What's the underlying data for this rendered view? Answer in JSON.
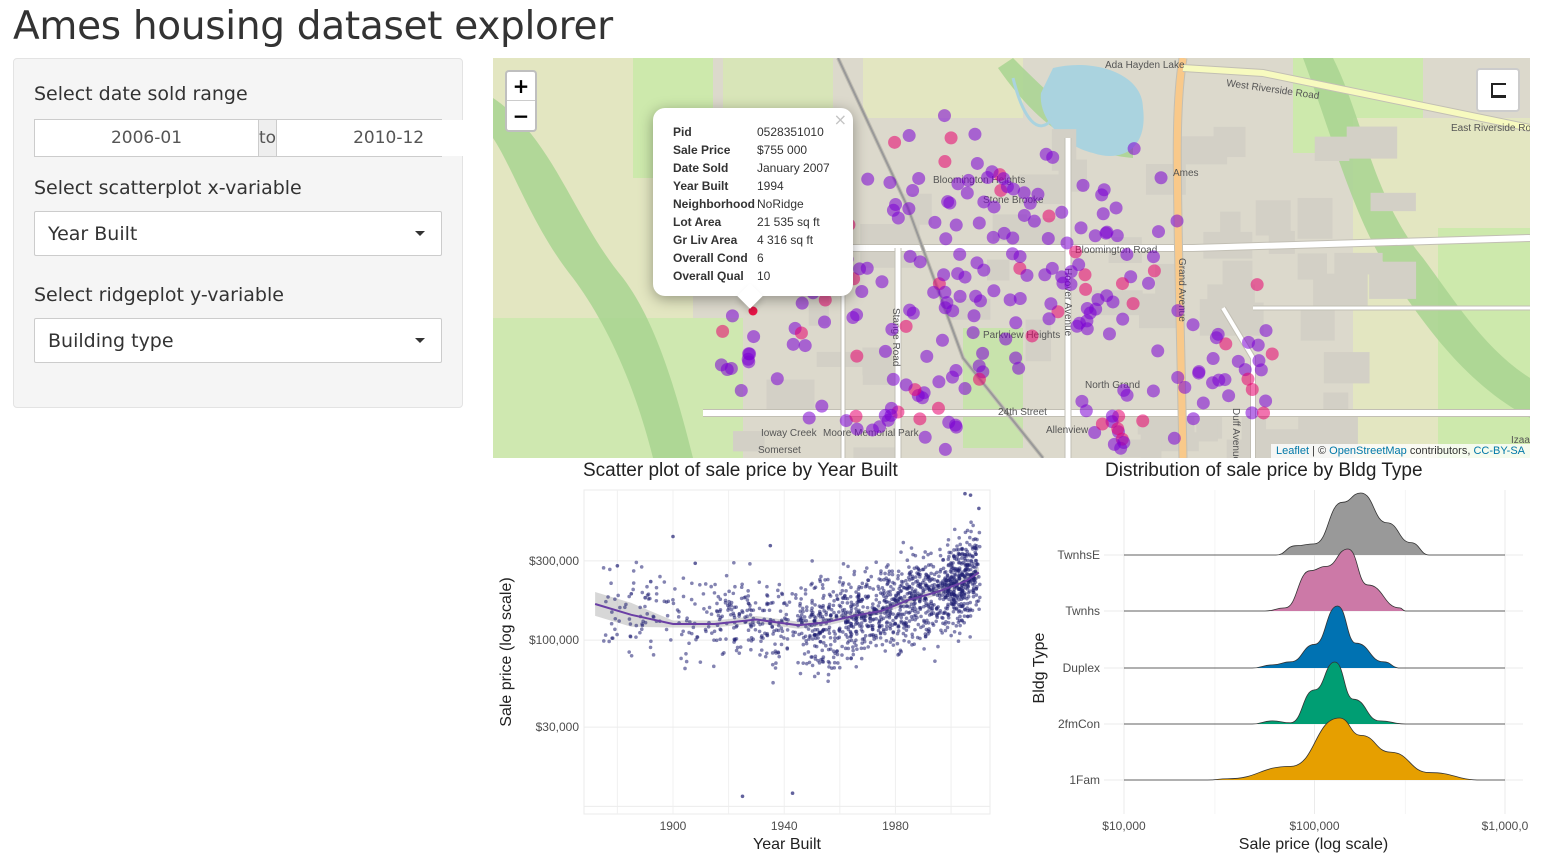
{
  "app": {
    "title": "Ames housing dataset explorer"
  },
  "sidebar": {
    "date_label": "Select date sold range",
    "date_start": "2006-01",
    "date_sep": "to",
    "date_end": "2010-12",
    "x_label": "Select scatterplot x-variable",
    "x_value": "Year Built",
    "y_label": "Select ridgeplot y-variable",
    "y_value": "Building type"
  },
  "map": {
    "zoom_in": "+",
    "zoom_out": "−",
    "popup": {
      "close": "×",
      "rows": [
        {
          "k": "Pid",
          "v": "0528351010"
        },
        {
          "k": "Sale Price",
          "v": "$755 000"
        },
        {
          "k": "Date Sold",
          "v": "January 2007"
        },
        {
          "k": "Year Built",
          "v": "1994"
        },
        {
          "k": "Neighborhood",
          "v": "NoRidge"
        },
        {
          "k": "Lot Area",
          "v": "21 535 sq ft"
        },
        {
          "k": "Gr Liv Area",
          "v": "4 316 sq ft"
        },
        {
          "k": "Overall Cond",
          "v": "6"
        },
        {
          "k": "Overall Qual",
          "v": "10"
        }
      ]
    },
    "labels": [
      "Ada Hayden Lake",
      "West Riverside Road",
      "East Riverside Road",
      "Ames",
      "Bloomington Heights",
      "Stone Brooke",
      "Bloomington Road",
      "Grand Avenue",
      "Hoover Avenue",
      "Stange Road",
      "Parkview Heights",
      "North Grand",
      "24th Street",
      "Duff Avenue",
      "Ioway Creek",
      "Moore Memorial Park",
      "Allenview",
      "Somerset",
      "Izaak"
    ],
    "attribution": {
      "leaflet": "Leaflet",
      "sep": " | © ",
      "osm": "OpenStreetMap",
      "contrib": " contributors, ",
      "license": "CC-BY-SA"
    },
    "marker_colors": {
      "low": "#7b00d4",
      "high": "#e8006e",
      "selected": "#e8003a"
    }
  },
  "chart_data": [
    {
      "type": "scatter",
      "title": "Scatter plot of sale price by Year Built",
      "xlabel": "Year Built",
      "ylabel": "Sale price (log scale)",
      "xlim": [
        1868,
        2014
      ],
      "ylim": [
        9000,
        800000
      ],
      "y_scale": "log",
      "xticks": [
        1900,
        1940,
        1980
      ],
      "yticks": [
        30000,
        100000,
        300000
      ],
      "ytick_labels": [
        "$30,000",
        "$100,000",
        "$300,000"
      ],
      "grid": true,
      "point_color": "#1f1f73",
      "smooth_color": "#6a3fa5",
      "smooth": {
        "x": [
          1872,
          1885,
          1900,
          1915,
          1930,
          1945,
          1955,
          1965,
          1975,
          1985,
          1995,
          2005,
          2010
        ],
        "y": [
          165000,
          142000,
          125000,
          125000,
          133000,
          123000,
          128000,
          140000,
          150000,
          175000,
          195000,
          225000,
          255000
        ]
      },
      "points": {
        "note": "approximately 2900 individual sales; representative cloud density",
        "outliers": [
          [
            1880,
            280000
          ],
          [
            1885,
            190000
          ],
          [
            1892,
            225000
          ],
          [
            1890,
            180000
          ],
          [
            1900,
            420000
          ],
          [
            1908,
            290000
          ],
          [
            1935,
            370000
          ],
          [
            1943,
            12000
          ],
          [
            1925,
            11500
          ],
          [
            2005,
            760000
          ],
          [
            2007,
            745000
          ],
          [
            2010,
            620000
          ]
        ]
      }
    },
    {
      "type": "area",
      "subtype": "ridgeline",
      "title": "Distribution of sale price by Bldg Type",
      "xlabel": "Sale price (log scale)",
      "ylabel": "Bldg Type",
      "x_scale": "log",
      "xlim": [
        10000,
        1000000
      ],
      "xticks": [
        10000,
        100000,
        1000000
      ],
      "xtick_labels": [
        "$10,000",
        "$100,000",
        "$1,000,0"
      ],
      "categories": [
        "1Fam",
        "2fmCon",
        "Duplex",
        "Twnhs",
        "TwnhsE"
      ],
      "series": [
        {
          "name": "1Fam",
          "color": "#e69f00",
          "peaks": [
            [
              35000,
              0.02
            ],
            [
              75000,
              0.22
            ],
            [
              135000,
              1.0
            ],
            [
              175000,
              0.72
            ],
            [
              250000,
              0.45
            ],
            [
              400000,
              0.12
            ],
            [
              750000,
              0.0
            ]
          ]
        },
        {
          "name": "2fmCon",
          "color": "#009e73",
          "peaks": [
            [
              60000,
              0.05
            ],
            [
              75000,
              0.02
            ],
            [
              100000,
              0.55
            ],
            [
              128000,
              1.0
            ],
            [
              160000,
              0.4
            ],
            [
              220000,
              0.05
            ],
            [
              300000,
              0.0
            ]
          ]
        },
        {
          "name": "Duplex",
          "color": "#0072b2",
          "peaks": [
            [
              60000,
              0.05
            ],
            [
              75000,
              0.1
            ],
            [
              100000,
              0.38
            ],
            [
              132000,
              1.0
            ],
            [
              165000,
              0.4
            ],
            [
              230000,
              0.1
            ],
            [
              280000,
              0.0
            ]
          ]
        },
        {
          "name": "Twnhs",
          "color": "#cc79a7",
          "peaks": [
            [
              70000,
              0.05
            ],
            [
              95000,
              0.65
            ],
            [
              115000,
              0.72
            ],
            [
              150000,
              1.0
            ],
            [
              190000,
              0.42
            ],
            [
              280000,
              0.05
            ],
            [
              300000,
              0.0
            ]
          ]
        },
        {
          "name": "TwnhsE",
          "color": "#999999",
          "peaks": [
            [
              80000,
              0.15
            ],
            [
              100000,
              0.18
            ],
            [
              140000,
              0.85
            ],
            [
              175000,
              1.0
            ],
            [
              240000,
              0.52
            ],
            [
              320000,
              0.2
            ],
            [
              400000,
              0.0
            ]
          ]
        }
      ]
    }
  ]
}
